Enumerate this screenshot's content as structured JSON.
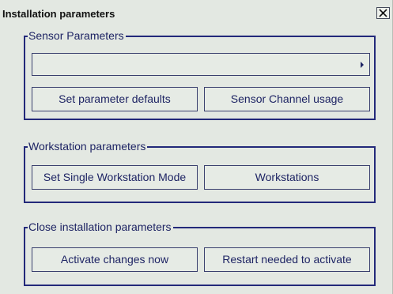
{
  "dialog": {
    "title": "Installation parameters",
    "close_icon": "close-icon"
  },
  "sensor": {
    "legend": "Sensor Parameters",
    "selector_value": "",
    "selector_icon": "triangle-right-icon",
    "set_defaults_label": "Set parameter defaults",
    "channel_usage_label": "Sensor Channel usage"
  },
  "workstation": {
    "legend": "Workstation parameters",
    "single_mode_label": "Set Single Workstation Mode",
    "workstations_label": "Workstations"
  },
  "close_params": {
    "legend": "Close installation parameters",
    "activate_now_label": "Activate changes now",
    "restart_label": "Restart needed to activate"
  },
  "colors": {
    "background": "#e3e8e2",
    "frame": "#23297a",
    "text": "#1e2464"
  }
}
